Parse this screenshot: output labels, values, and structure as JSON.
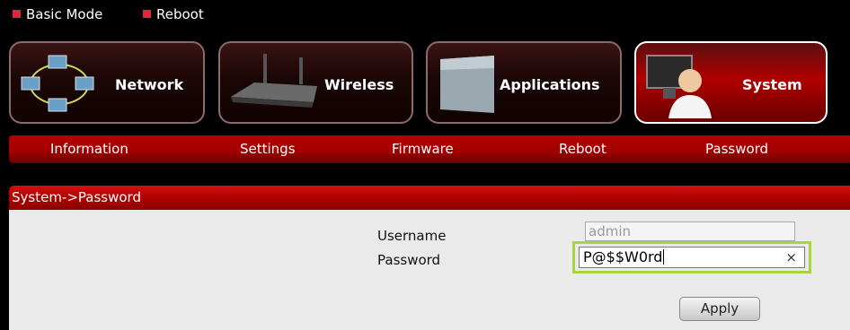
{
  "top_links": {
    "basic_mode": "Basic Mode",
    "reboot": "Reboot"
  },
  "tabs": [
    {
      "label": "Network",
      "icon": "network-icon"
    },
    {
      "label": "Wireless",
      "icon": "router-icon"
    },
    {
      "label": "Applications",
      "icon": "device-icon"
    },
    {
      "label": "System",
      "icon": "user-computer-icon"
    }
  ],
  "active_tab": "System",
  "subnav": [
    "Information",
    "Settings",
    "Firmware",
    "Reboot",
    "Password"
  ],
  "panel": {
    "title": "System->Password",
    "username_label": "Username",
    "password_label": "Password",
    "username_value": "admin",
    "password_value": "P@$$W0rd",
    "clear_symbol": "×",
    "apply_label": "Apply"
  },
  "colors": {
    "accent": "#b00000",
    "focus_highlight": "#a6d63a",
    "square_bullet": "#e8233c"
  }
}
